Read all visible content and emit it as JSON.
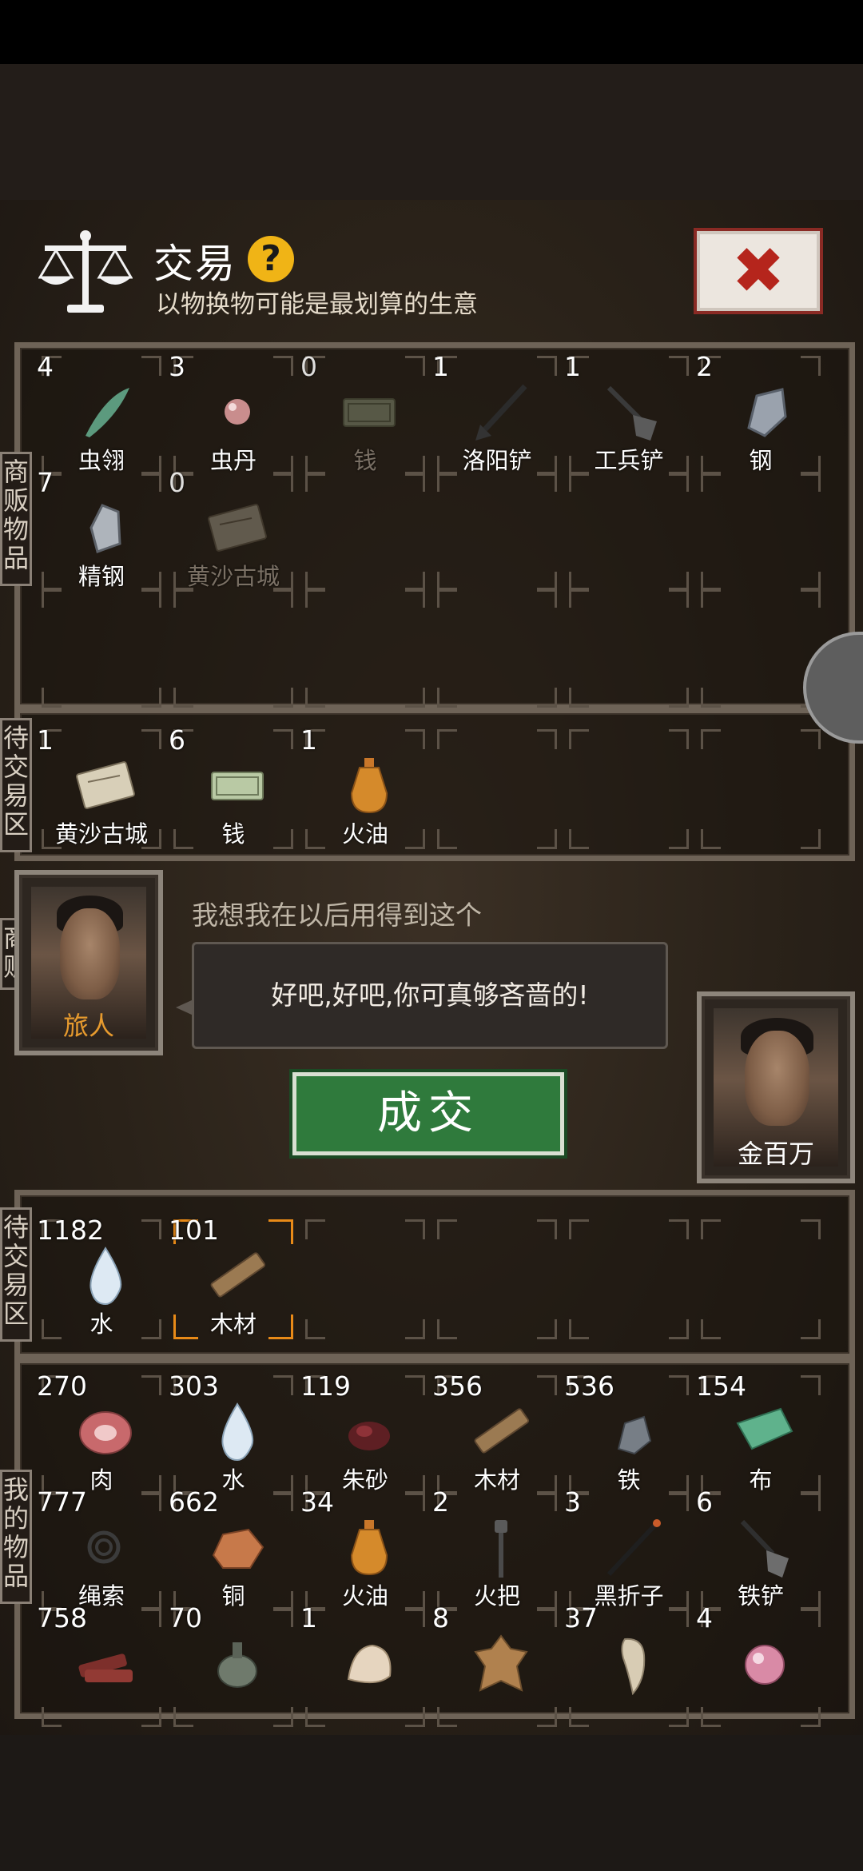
{
  "header": {
    "title": "交易",
    "subtitle": "以物换物可能是最划算的生意"
  },
  "labels": {
    "merchant_goods": "商\n贩\n物\n品",
    "trade_zone_top": "待\n交\n易\n区",
    "merchant": "商\n贩",
    "trade_zone_bottom": "待\n交\n易\n区",
    "my_items": "我\n的\n物\n品"
  },
  "merchant_goods": [
    {
      "count": "4",
      "name": "虫翎",
      "icon": "feather-icon",
      "dim": false
    },
    {
      "count": "3",
      "name": "虫丹",
      "icon": "pearl-icon",
      "dim": false
    },
    {
      "count": "0",
      "name": "钱",
      "icon": "money-icon",
      "dim": true
    },
    {
      "count": "1",
      "name": "洛阳铲",
      "icon": "shovel-icon",
      "dim": false
    },
    {
      "count": "1",
      "name": "工兵铲",
      "icon": "spade-icon",
      "dim": false
    },
    {
      "count": "2",
      "name": "钢",
      "icon": "steel-icon",
      "dim": false
    },
    {
      "count": "7",
      "name": "精钢",
      "icon": "fine-steel-icon",
      "dim": false
    },
    {
      "count": "0",
      "name": "黄沙古城",
      "icon": "map-icon",
      "dim": true
    }
  ],
  "merchant_offer": [
    {
      "count": "1",
      "name": "黄沙古城",
      "icon": "map-icon"
    },
    {
      "count": "6",
      "name": "钱",
      "icon": "money-icon"
    },
    {
      "count": "1",
      "name": "火油",
      "icon": "oil-bottle-icon"
    }
  ],
  "traveler": {
    "name": "旅人"
  },
  "speech_label": "我想我在以后用得到这个",
  "speech_bubble": "好吧,好吧,你可真够吝啬的!",
  "deal_button": "成交",
  "player": {
    "name": "金百万"
  },
  "my_offer": [
    {
      "count": "1182",
      "name": "水",
      "icon": "water-drop-icon",
      "selected": false
    },
    {
      "count": "101",
      "name": "木材",
      "icon": "wood-icon",
      "selected": true
    }
  ],
  "my_items": [
    {
      "count": "270",
      "name": "肉",
      "icon": "meat-icon"
    },
    {
      "count": "303",
      "name": "水",
      "icon": "water-drop-icon"
    },
    {
      "count": "119",
      "name": "朱砂",
      "icon": "cinnabar-icon"
    },
    {
      "count": "356",
      "name": "木材",
      "icon": "wood-icon"
    },
    {
      "count": "536",
      "name": "铁",
      "icon": "iron-icon"
    },
    {
      "count": "154",
      "name": "布",
      "icon": "cloth-icon"
    },
    {
      "count": "777",
      "name": "绳索",
      "icon": "rope-icon"
    },
    {
      "count": "662",
      "name": "铜",
      "icon": "copper-icon"
    },
    {
      "count": "34",
      "name": "火油",
      "icon": "oil-bottle-icon"
    },
    {
      "count": "2",
      "name": "火把",
      "icon": "torch-icon"
    },
    {
      "count": "3",
      "name": "黑折子",
      "icon": "black-stick-icon"
    },
    {
      "count": "6",
      "name": "铁铲",
      "icon": "iron-shovel-icon"
    },
    {
      "count": "758",
      "name": "",
      "icon": "jerky-icon"
    },
    {
      "count": "70",
      "name": "",
      "icon": "flask-icon"
    },
    {
      "count": "1",
      "name": "",
      "icon": "bone-icon"
    },
    {
      "count": "8",
      "name": "",
      "icon": "hide-icon"
    },
    {
      "count": "37",
      "name": "",
      "icon": "tooth-icon"
    },
    {
      "count": "4",
      "name": "",
      "icon": "orb-icon"
    }
  ],
  "colors": {
    "accent_select": "#e88a18",
    "deal_green": "#2f7a3c",
    "close_red": "#b5251c",
    "help_yellow": "#f0b416"
  }
}
